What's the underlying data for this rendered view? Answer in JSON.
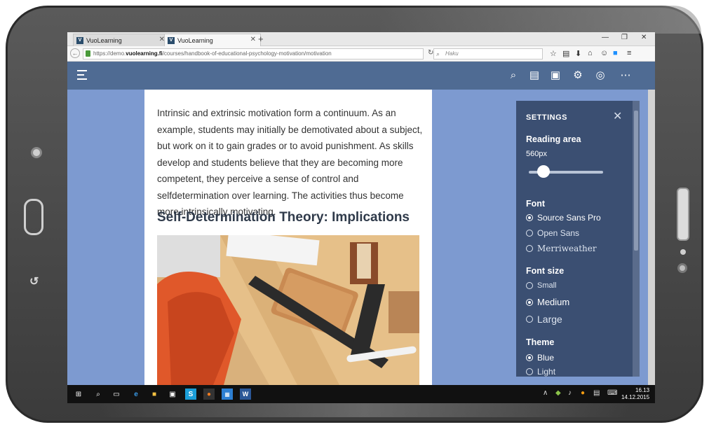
{
  "browser": {
    "tabs": [
      {
        "label": "VuoLearning",
        "active": false
      },
      {
        "label": "VuoLearning",
        "active": true
      }
    ],
    "url_prefix": "https://demo.",
    "url_host": "vuolearning.fi",
    "url_path": "/courses/handbook-of-educational-psychology-motivation/motivation",
    "search_placeholder": "Haku"
  },
  "article": {
    "paragraph": "Intrinsic and extrinsic motivation form a continuum. As an example, students may initially be demotivated about a subject, but work on it to gain grades or to avoid punishment. As skills develop and students believe that they are becoming more competent, they perceive a sense of control and selfdetermination over learning. The activities thus become more intrinsically motivating.",
    "heading": "Self-Determination Theory: Implications"
  },
  "settings": {
    "title": "SETTINGS",
    "reading_area_label": "Reading area",
    "reading_area_value": "560px",
    "reading_area_slider_level": 0.2,
    "font_label": "Font",
    "font_options": [
      "Source Sans Pro",
      "Open Sans",
      "Merriweather"
    ],
    "font_selected": "Source Sans Pro",
    "font_size_label": "Font size",
    "font_size_options": [
      "Small",
      "Medium",
      "Large"
    ],
    "font_size_selected": "Medium",
    "theme_label": "Theme",
    "theme_options": [
      "Blue",
      "Light"
    ],
    "theme_selected": "Blue"
  },
  "taskbar": {
    "time": "16.13",
    "date": "14.12.2015"
  },
  "colors": {
    "header": "#4f6b93",
    "content_bg": "#7d9ad0",
    "settings_panel": "#3b4f72"
  }
}
